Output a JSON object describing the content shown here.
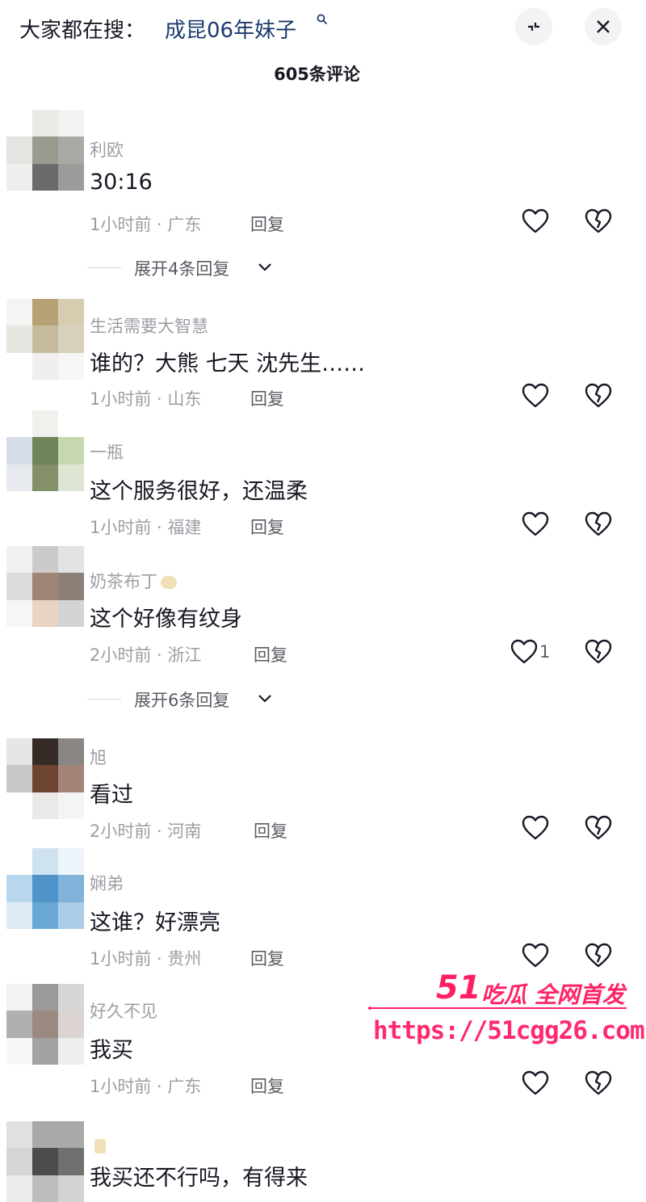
{
  "header": {
    "search_prefix": "大家都在搜：",
    "search_term": "成昆06年妹子",
    "comment_count": "605条评论"
  },
  "comments": [
    {
      "user": "利欧",
      "text": "30:16",
      "time": "1小时前",
      "region": "广东",
      "reply": "回复",
      "likes": "",
      "expand": "展开4条回复"
    },
    {
      "user": "生活需要大智慧",
      "text": "谁的？大熊 七天 沈先生……",
      "time": "1小时前",
      "region": "山东",
      "reply": "回复",
      "likes": "",
      "expand": ""
    },
    {
      "user": "一瓶",
      "text": "这个服务很好，还温柔",
      "time": "1小时前",
      "region": "福建",
      "reply": "回复",
      "likes": "",
      "expand": ""
    },
    {
      "user": "奶茶布丁",
      "text": "这个好像有纹身",
      "time": "2小时前",
      "region": "浙江",
      "reply": "回复",
      "likes": "1",
      "expand": "展开6条回复"
    },
    {
      "user": "旭",
      "text": "看过",
      "time": "2小时前",
      "region": "河南",
      "reply": "回复",
      "likes": "",
      "expand": ""
    },
    {
      "user": "娴弟",
      "text": "这谁？好漂亮",
      "time": "1小时前",
      "region": "贵州",
      "reply": "回复",
      "likes": "",
      "expand": ""
    },
    {
      "user": "好久不见",
      "text": "我买",
      "time": "1小时前",
      "region": "广东",
      "reply": "回复",
      "likes": "",
      "expand": ""
    },
    {
      "user": "",
      "text": "我买还不行吗，有得来",
      "time": "",
      "region": "",
      "reply": "",
      "likes": "",
      "expand": ""
    }
  ],
  "watermark": {
    "num": "51",
    "title": "吃瓜 全网首发",
    "url": "https://51cgg26.com"
  },
  "colors": {
    "text": "#161823",
    "meta": "#9c9ea4",
    "search_term": "#1c3a6e",
    "watermark": "#ff2467"
  }
}
